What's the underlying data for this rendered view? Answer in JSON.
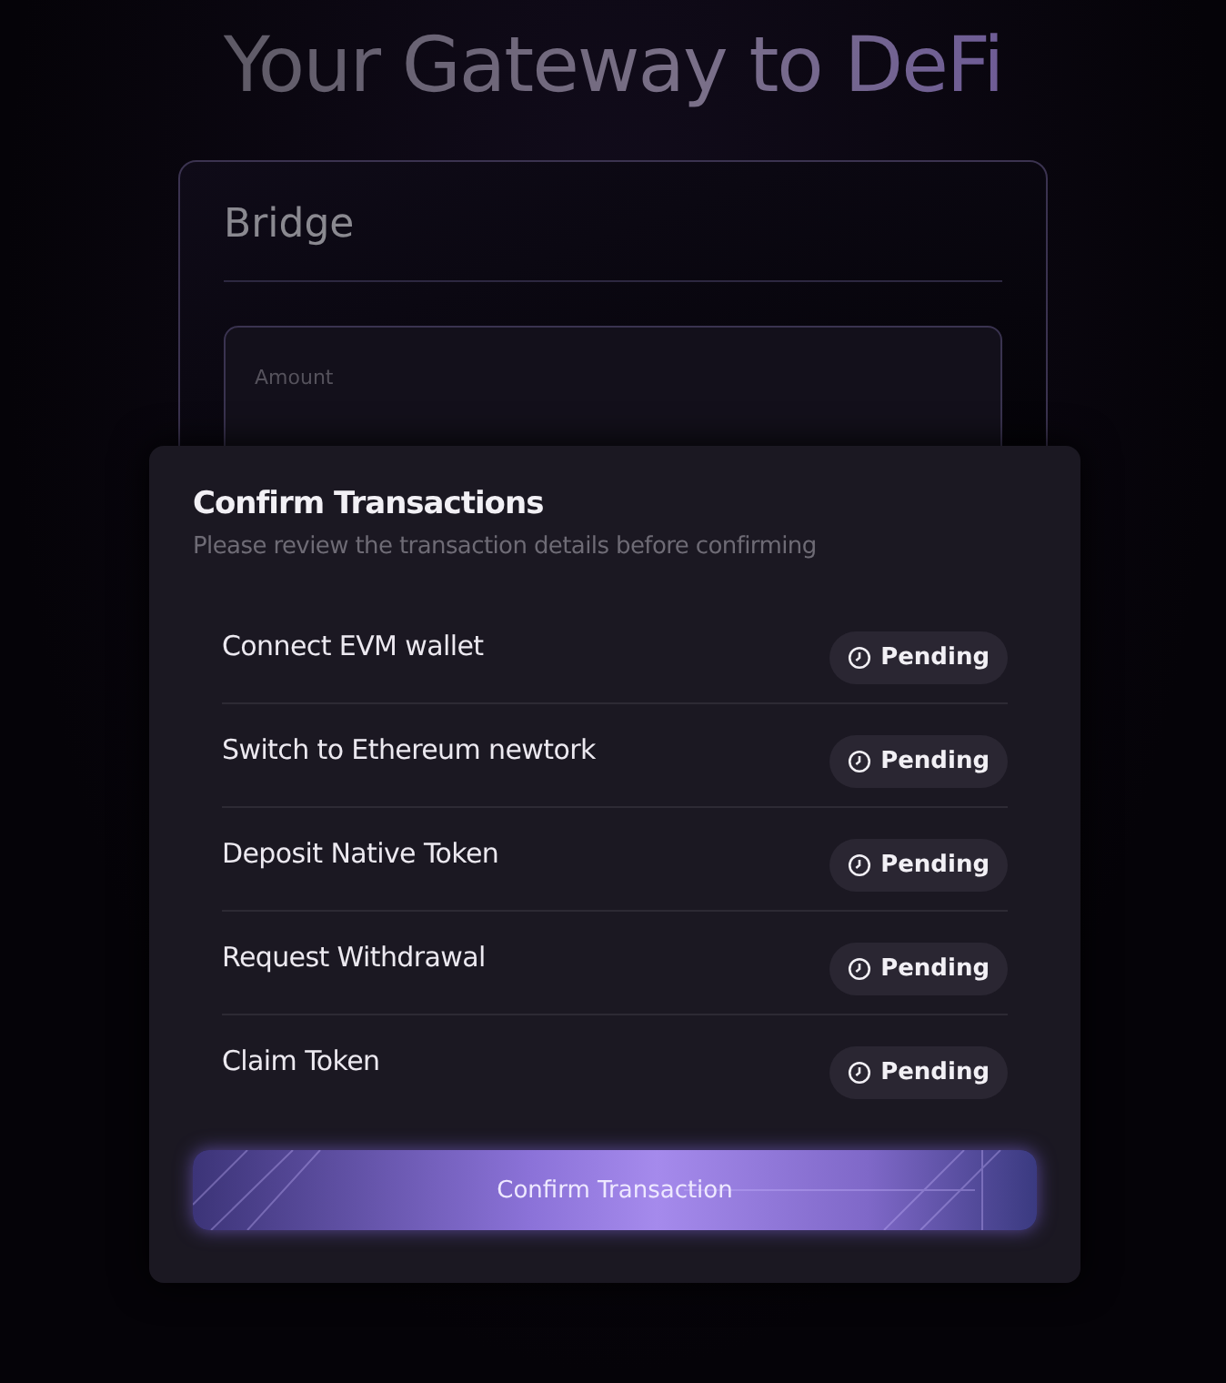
{
  "heading": "Your Gateway to DeFi",
  "bridge": {
    "title": "Bridge",
    "amount_label": "Amount"
  },
  "modal": {
    "title": "Confirm Transactions",
    "subtitle": "Please review the transaction details before confirming",
    "steps": [
      {
        "label": "Connect EVM wallet",
        "status": "Pending"
      },
      {
        "label": "Switch to Ethereum newtork",
        "status": "Pending"
      },
      {
        "label": "Deposit Native Token",
        "status": "Pending"
      },
      {
        "label": "Request Withdrawal",
        "status": "Pending"
      },
      {
        "label": "Claim Token",
        "status": "Pending"
      }
    ],
    "button": "Confirm Transaction"
  }
}
